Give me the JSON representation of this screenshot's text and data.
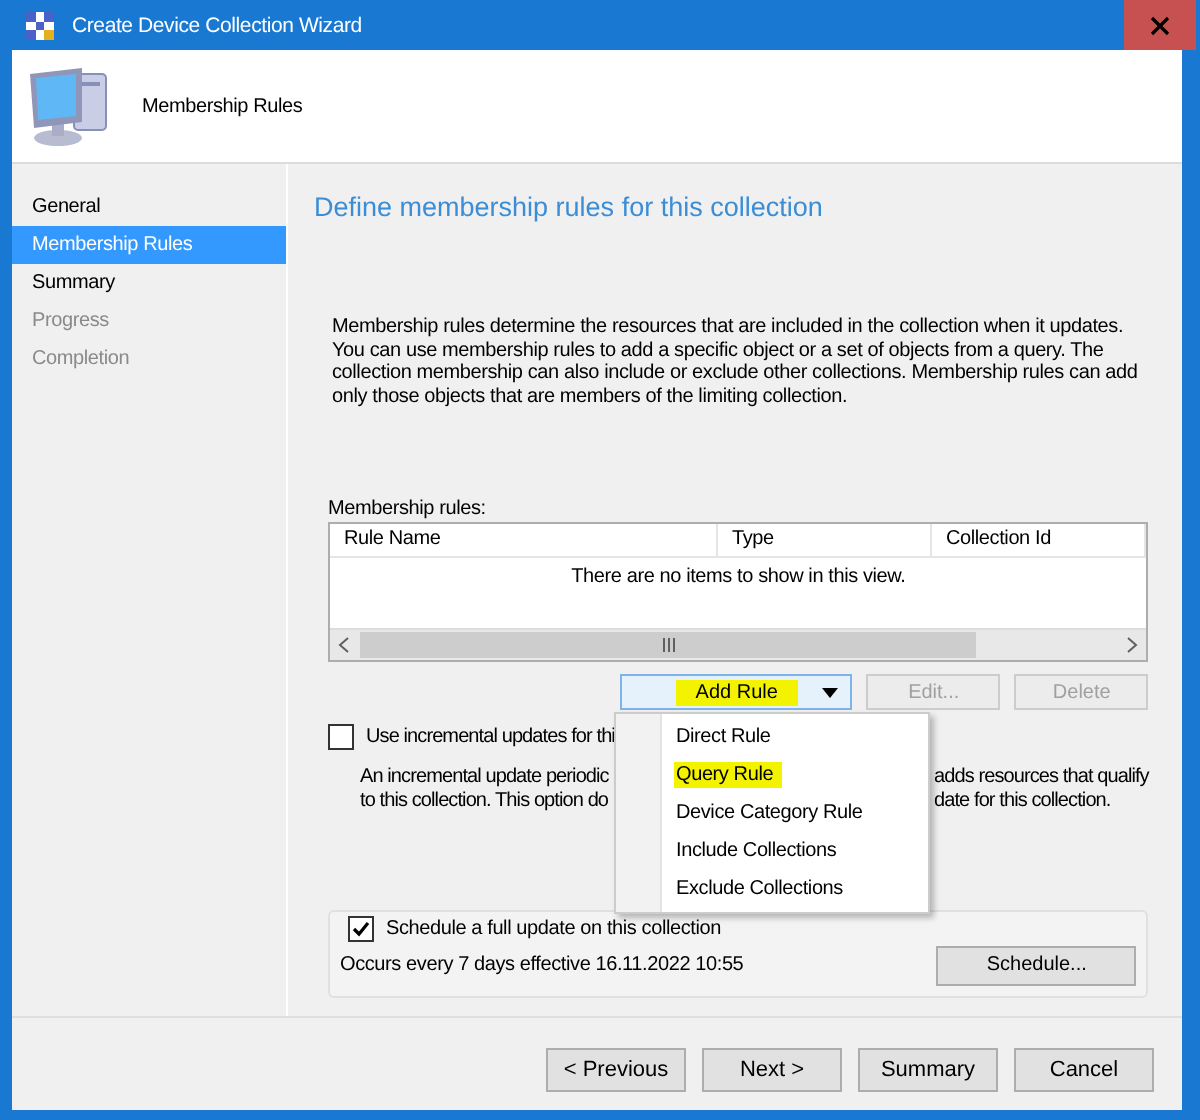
{
  "window": {
    "title": "Create Device Collection Wizard"
  },
  "header": {
    "title": "Membership Rules"
  },
  "nav": {
    "items": [
      {
        "label": "General",
        "selected": false,
        "disabled": false
      },
      {
        "label": "Membership Rules",
        "selected": true,
        "disabled": false
      },
      {
        "label": "Summary",
        "selected": false,
        "disabled": false
      },
      {
        "label": "Progress",
        "selected": false,
        "disabled": true
      },
      {
        "label": "Completion",
        "selected": false,
        "disabled": true
      }
    ]
  },
  "page": {
    "heading": "Define membership rules for this collection",
    "description": "Membership rules determine the resources that are included in the collection when it updates. You can use membership rules to add a specific object or a set of objects from a query. The collection membership can also include or exclude other collections. Membership rules can add only those objects that are members of the limiting collection.",
    "rules_label": "Membership rules:",
    "table": {
      "columns": [
        "Rule Name",
        "Type",
        "Collection Id"
      ],
      "empty_message": "There are no items to show in this view."
    },
    "rule_buttons": [
      {
        "label": "Add Rule",
        "kind": "dropdown",
        "disabled": false,
        "highlighted": true
      },
      {
        "label": "Edit...",
        "kind": "plain",
        "disabled": true,
        "highlighted": false
      },
      {
        "label": "Delete",
        "kind": "plain",
        "disabled": true,
        "highlighted": false
      }
    ],
    "add_rule_menu": [
      {
        "label": "Direct Rule",
        "highlighted": false
      },
      {
        "label": "Query Rule",
        "highlighted": true
      },
      {
        "label": "Device Category Rule",
        "highlighted": false
      },
      {
        "label": "Include Collections",
        "highlighted": false
      },
      {
        "label": "Exclude Collections",
        "highlighted": false
      }
    ],
    "incremental": {
      "label": "Use incremental updates for thi",
      "checked": false,
      "description_lines": [
        {
          "left": "An incremental update periodic",
          "right": "adds resources that qualify"
        },
        {
          "left": "to this collection. This option do",
          "right": "date for this collection."
        }
      ]
    },
    "schedule": {
      "label": "Schedule a full update on this collection",
      "checked": true,
      "summary": "Occurs every 7 days effective 16.11.2022 10:55",
      "button": "Schedule..."
    }
  },
  "footer_buttons": [
    "< Previous",
    "Next >",
    "Summary",
    "Cancel"
  ]
}
